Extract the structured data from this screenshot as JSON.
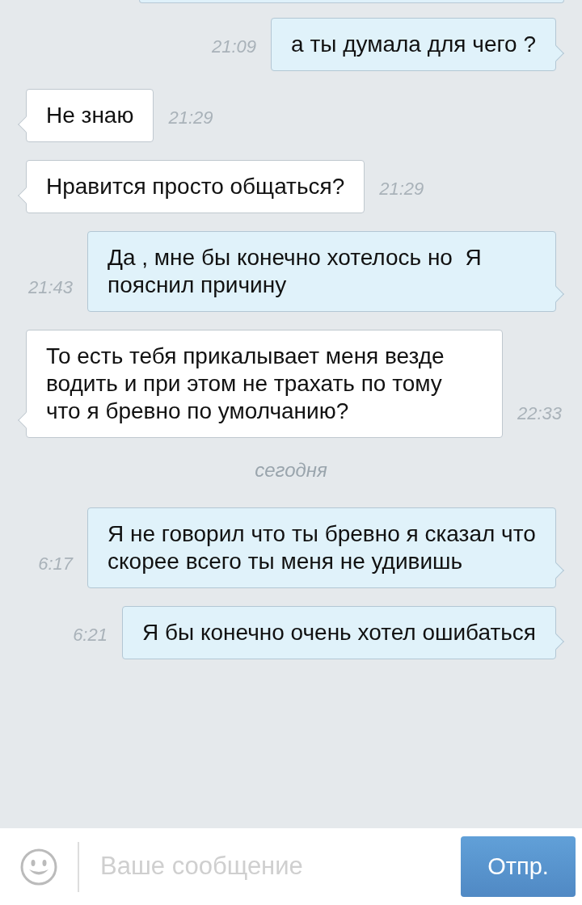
{
  "messages": [
    {
      "kind": "sent",
      "text": "а ты думала для чего ?",
      "time": "21:09"
    },
    {
      "kind": "received",
      "text": "Не знаю",
      "time": "21:29"
    },
    {
      "kind": "received",
      "text": "Нравится просто общаться?",
      "time": "21:29"
    },
    {
      "kind": "sent",
      "text": "Да , мне бы конечно хотелось но  Я пояснил причину",
      "time": "21:43"
    },
    {
      "kind": "received",
      "text": "То есть тебя прикалывает меня везде водить и при этом не трахать по тому что я бревно по умолчанию?",
      "time": "22:33"
    },
    {
      "kind": "date",
      "text": "сегодня"
    },
    {
      "kind": "sent",
      "text": "Я не говорил что ты бревно я сказал что скорее всего ты меня не удивишь",
      "time": "6:17"
    },
    {
      "kind": "sent",
      "text": "Я бы конечно очень хотел ошибаться",
      "time": "6:21"
    }
  ],
  "composer": {
    "placeholder": "Ваше сообщение",
    "send_label": "Отпр."
  }
}
